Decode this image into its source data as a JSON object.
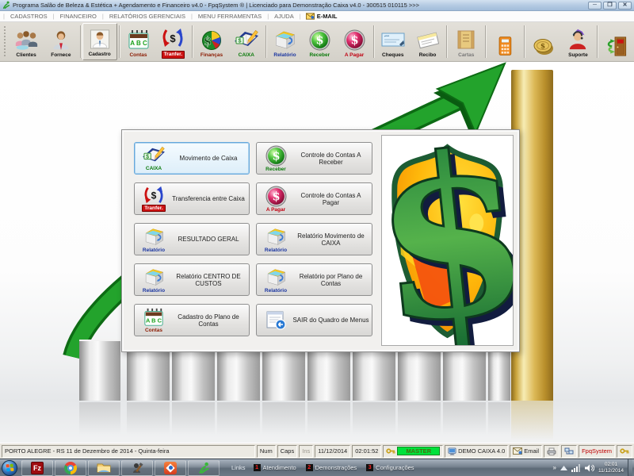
{
  "window": {
    "title": "Programa Salão de Beleza & Estética + Agendamento e Financeiro v4.0 - FpqSystem ® | Licenciado para  Demonstração Caixa v4.0 - 300515 010115 >>>",
    "icon": "fpq-logo-icon",
    "controls": {
      "minimize": "─",
      "restore": "❐",
      "close": "✕"
    }
  },
  "menu": {
    "items": [
      "CADASTROS",
      "FINANCEIRO",
      "RELATÓRIOS GERENCIAIS",
      "MENU FERRAMENTAS",
      "AJUDA"
    ],
    "email_label": "E-MAIL"
  },
  "toolbar": {
    "buttons": [
      {
        "label": "Clientes",
        "icon": "clients-icon"
      },
      {
        "label": "Fornece",
        "icon": "supplier-icon"
      },
      {
        "label": "Cadastro",
        "icon": "registry-icon"
      },
      {
        "label": "Contas",
        "icon": "accounts-calendar-icon"
      },
      {
        "label": "Tranfer.",
        "icon": "transfer-icon"
      },
      {
        "label": "Finanças",
        "icon": "finance-pie-icon"
      },
      {
        "label": "CAIXA",
        "icon": "cashbook-icon"
      },
      {
        "label": "Relatório",
        "icon": "report-icon"
      },
      {
        "label": "Receber",
        "icon": "receive-dollar-icon"
      },
      {
        "label": "A Pagar",
        "icon": "pay-dollar-icon"
      },
      {
        "label": "Cheques",
        "icon": "cheques-icon"
      },
      {
        "label": "Recibo",
        "icon": "receipt-icon"
      },
      {
        "label": "Cartas",
        "icon": "letters-scroll-icon"
      },
      {
        "label": "",
        "icon": "calculator-icon"
      },
      {
        "label": "",
        "icon": "coin-icon"
      },
      {
        "label": "Suporte",
        "icon": "support-icon"
      },
      {
        "label": "",
        "icon": "exit-door-icon"
      }
    ]
  },
  "dialog": {
    "buttons": [
      {
        "label": "Movimento de Caixa",
        "badge": "CAIXA",
        "icon": "cashbook-icon",
        "focused": true
      },
      {
        "label": "Controle do Contas A Receber",
        "badge": "Receber",
        "icon": "receive-dollar-icon"
      },
      {
        "label": "Transferencia entre Caixa",
        "badge": "Tranfer.",
        "icon": "transfer-icon"
      },
      {
        "label": "Controle do Contas A Pagar",
        "badge": "A Pagar",
        "icon": "pay-dollar-icon"
      },
      {
        "label": "RESULTADO GERAL",
        "badge": "Relatório",
        "icon": "report-icon"
      },
      {
        "label": "Relatório Movimento de CAIXA",
        "badge": "Relatório",
        "icon": "report-icon"
      },
      {
        "label": "Relatório CENTRO DE CUSTOS",
        "badge": "Relatório",
        "icon": "report-icon"
      },
      {
        "label": "Relatório por Plano de Contas",
        "badge": "Relatório",
        "icon": "report-icon"
      },
      {
        "label": "Cadastro do Plano de Contas",
        "badge": "Contas",
        "icon": "accounts-calendar-icon"
      },
      {
        "label": "SAIR do Quadro de Menus",
        "badge": "",
        "icon": "exit-menu-window-icon"
      }
    ]
  },
  "statusbar": {
    "location": "PORTO ALEGRE - RS 11 de Dezembro de 2014 - Quinta-feira",
    "num": "Num",
    "caps": "Caps",
    "ins": "Ins",
    "date": "11/12/2014",
    "time": "02:01:52",
    "user": "MASTER",
    "system": "DEMO CAIXA 4.0",
    "email": "Email",
    "brand": "FpqSystem"
  },
  "taskbar": {
    "filezilla_glyph": "Fz",
    "links_label": "Links",
    "links": [
      {
        "num": "1",
        "label": "Atendimento"
      },
      {
        "num": "2",
        "label": "Demonstrações"
      },
      {
        "num": "3",
        "label": "Configurações"
      }
    ],
    "overflow": "»",
    "clock": {
      "time": "02:01",
      "date": "11/12/2014"
    }
  },
  "colors": {
    "accent_green": "#23a32c",
    "gold": "#d9b64a",
    "master_bg": "#00e13b",
    "brand_red": "#c00000",
    "titlebar_blue": "#b3c9e2"
  }
}
